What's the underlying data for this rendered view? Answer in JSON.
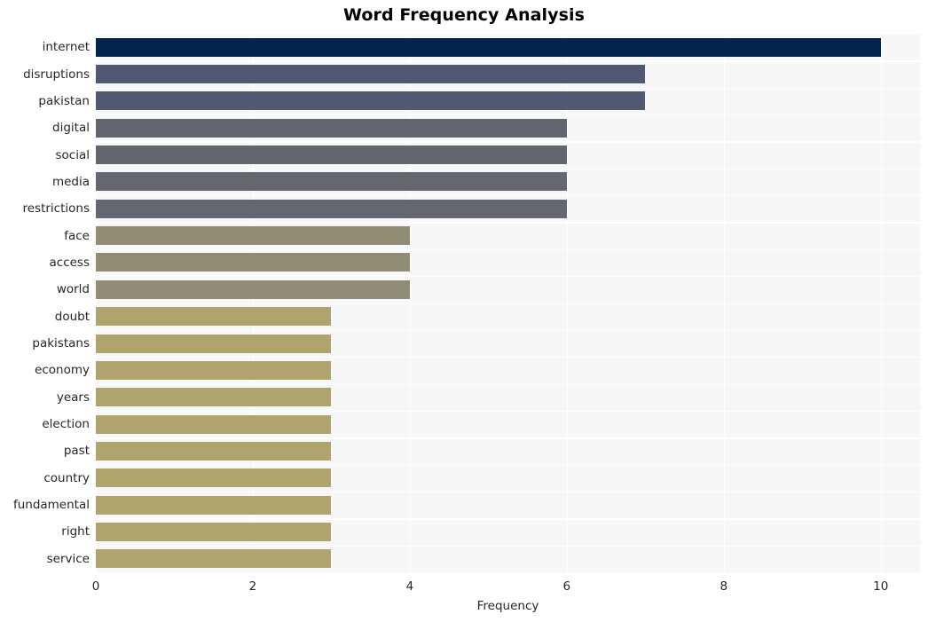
{
  "chart_data": {
    "type": "bar",
    "orientation": "horizontal",
    "title": "Word Frequency Analysis",
    "xlabel": "Frequency",
    "ylabel": "",
    "categories": [
      "internet",
      "disruptions",
      "pakistan",
      "digital",
      "social",
      "media",
      "restrictions",
      "face",
      "access",
      "world",
      "doubt",
      "pakistans",
      "economy",
      "years",
      "election",
      "past",
      "country",
      "fundamental",
      "right",
      "service"
    ],
    "values": [
      10,
      7,
      7,
      6,
      6,
      6,
      6,
      4,
      4,
      4,
      3,
      3,
      3,
      3,
      3,
      3,
      3,
      3,
      3,
      3
    ],
    "bar_colors": [
      "#04244e",
      "#505873",
      "#515872",
      "#62656e",
      "#63666f",
      "#64676f",
      "#64676f",
      "#918c74",
      "#918c74",
      "#908c75",
      "#afa46d",
      "#afa46d",
      "#afa46d",
      "#afa46d",
      "#afa46d",
      "#afa46d",
      "#afa46d",
      "#afa46d",
      "#afa46d",
      "#afa46d"
    ],
    "xlim": [
      0,
      10.5
    ],
    "xticks": [
      0,
      2,
      4,
      6,
      8,
      10
    ],
    "xtick_labels": [
      "0",
      "2",
      "4",
      "6",
      "8",
      "10"
    ],
    "grid": true,
    "grid_color": "#ffffff",
    "plot_background": "#f7f7f7",
    "figure_background": "#ffffff",
    "legend": null
  }
}
